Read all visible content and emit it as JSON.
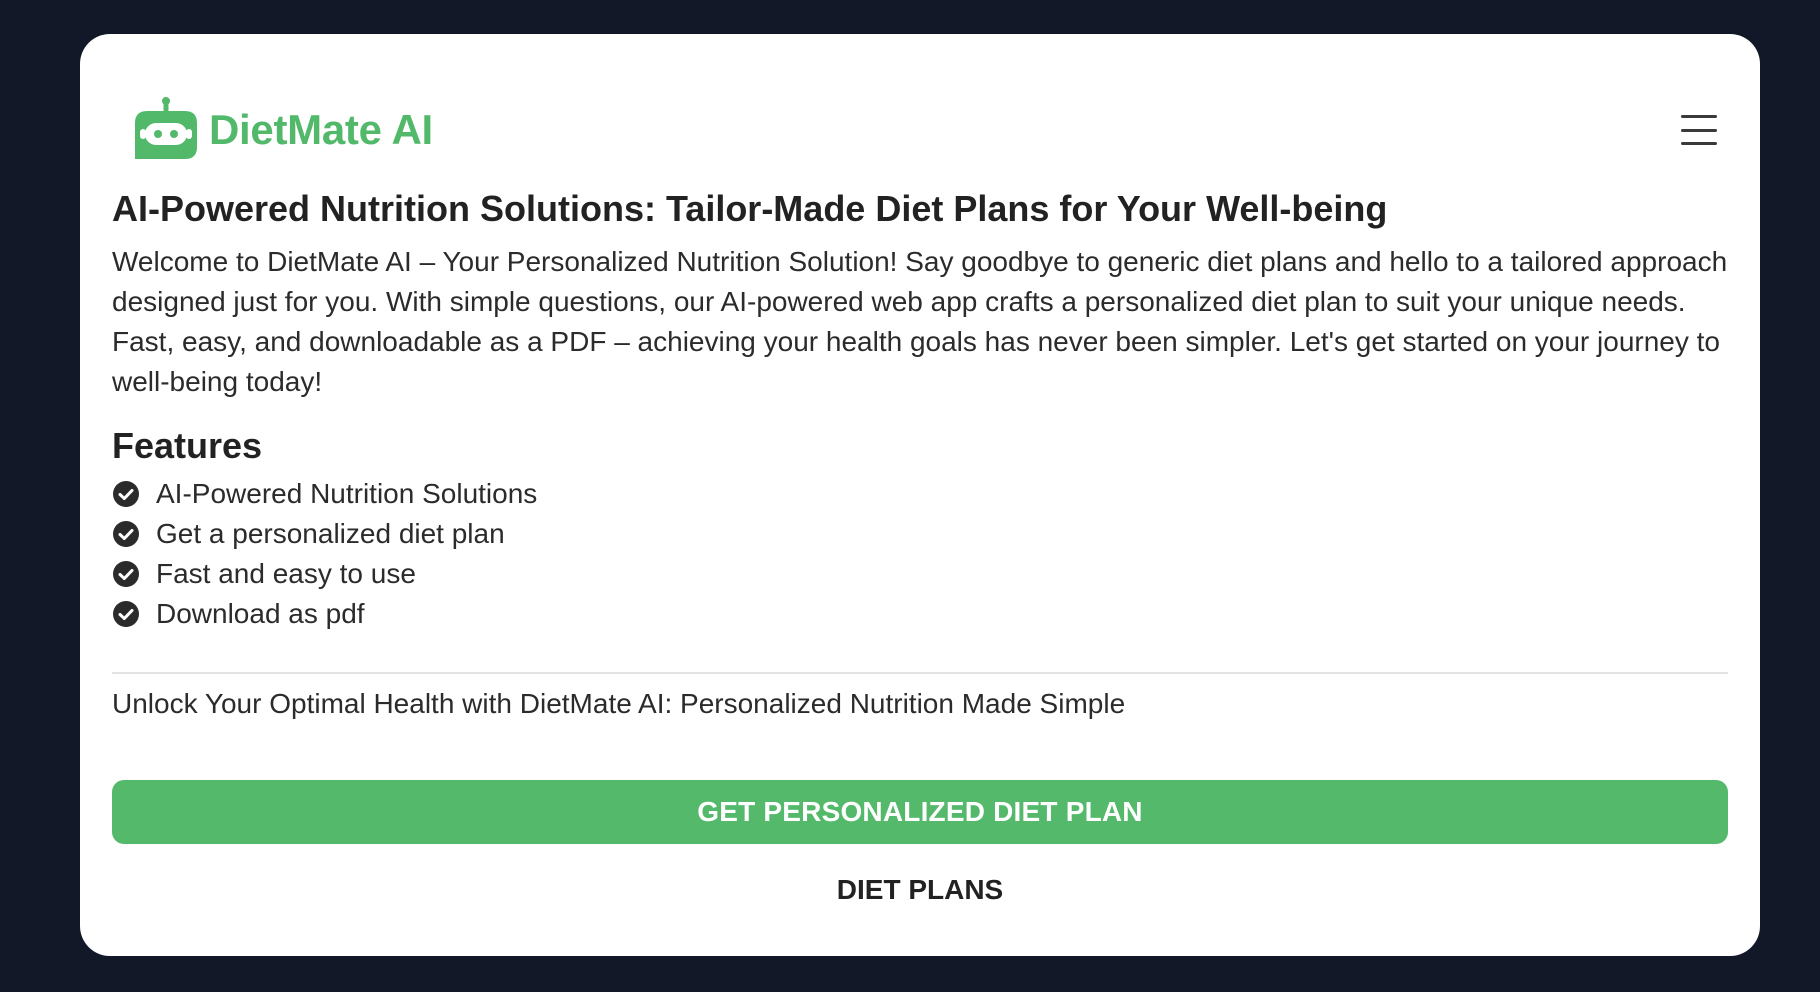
{
  "brand": {
    "name": "DietMate AI",
    "color": "#52b96a"
  },
  "header": {
    "menu_icon": "hamburger-menu-icon"
  },
  "main": {
    "title": "AI-Powered Nutrition Solutions: Tailor-Made Diet Plans for Your Well-being",
    "intro": "Welcome to DietMate AI – Your Personalized Nutrition Solution! Say goodbye to generic diet plans and hello to a tailored approach designed just for you. With simple questions, our AI-powered web app crafts a personalized diet plan to suit your unique needs. Fast, easy, and downloadable as a PDF – achieving your health goals has never been simpler. Let's get started on your journey to well-being today!",
    "features_title": "Features",
    "features": [
      {
        "label": "AI-Powered Nutrition Solutions",
        "icon": "check-circle-icon"
      },
      {
        "label": "Get a personalized diet plan",
        "icon": "check-circle-icon"
      },
      {
        "label": "Fast and easy to use",
        "icon": "check-circle-icon"
      },
      {
        "label": "Download as pdf",
        "icon": "check-circle-icon"
      }
    ],
    "tagline": "Unlock Your Optimal Health with DietMate AI: Personalized Nutrition Made Simple"
  },
  "actions": {
    "primary_label": "GET PERSONALIZED DIET PLAN",
    "secondary_label": "DIET PLANS",
    "primary_color": "#54b96a"
  },
  "colors": {
    "page_background": "#121828",
    "card_background": "#ffffff"
  }
}
